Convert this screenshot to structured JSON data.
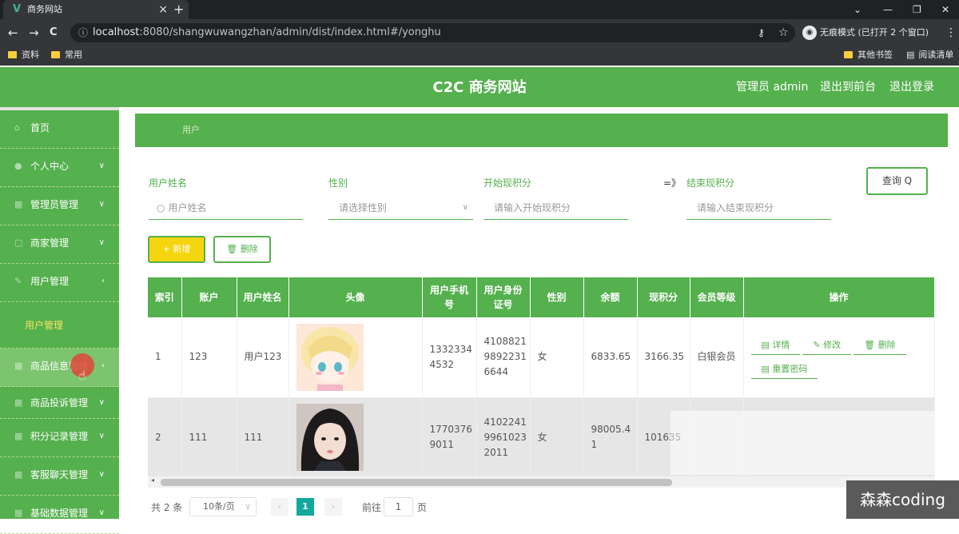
{
  "browser": {
    "tab_title": "商务网站",
    "tab_close": "×",
    "new_tab": "+",
    "url_host": "localhost",
    "url_rest": ":8080/shangwuwangzhan/admin/dist/index.html#/yonghu",
    "incognito_label": "无痕模式 (已打开 2 个窗口)",
    "bookmarks": [
      "资料",
      "常用"
    ],
    "bookmarks_right": [
      "其他书签",
      "阅读清单"
    ]
  },
  "header": {
    "title": "C2C 商务网站",
    "admin_label": "管理员 admin",
    "back_front": "退出到前台",
    "logout": "退出登录"
  },
  "sidebar": {
    "items": [
      {
        "label": "首页"
      },
      {
        "label": "个人中心"
      },
      {
        "label": "管理员管理"
      },
      {
        "label": "商家管理"
      },
      {
        "label": "用户管理"
      }
    ],
    "submenu_active": "用户管理",
    "items_after": [
      {
        "label": "商品信息管理"
      },
      {
        "label": "商品投诉管理"
      },
      {
        "label": "积分记录管理"
      },
      {
        "label": "客服聊天管理"
      },
      {
        "label": "基础数据管理"
      }
    ]
  },
  "breadcrumb": "用户",
  "search": {
    "name_label": "用户姓名",
    "name_placeholder": "用户姓名",
    "gender_label": "性别",
    "gender_placeholder": "请选择性别",
    "start_label": "开始现积分",
    "start_placeholder": "请输入开始现积分",
    "arrow": "=》",
    "end_label": "结束现积分",
    "end_placeholder": "请输入结束现积分",
    "query_button": "查询 Q"
  },
  "actions": {
    "add": "+ 新增",
    "delete": "删除"
  },
  "table": {
    "headers": [
      "索引",
      "账户",
      "用户姓名",
      "头像",
      "用户手机号",
      "用户身份证号",
      "性别",
      "余额",
      "现积分",
      "会员等级",
      "操作"
    ],
    "rows": [
      {
        "index": "1",
        "account": "123",
        "name": "用户123",
        "phone": "13323344532",
        "idcard": "410882198922316644",
        "gender": "女",
        "balance": "6833.65",
        "points": "3166.35",
        "level": "白银会员"
      },
      {
        "index": "2",
        "account": "111",
        "name": "111",
        "phone": "17703769011",
        "idcard": "410224199610232011",
        "gender": "女",
        "balance": "98005.41",
        "points": "101635",
        "level": ""
      }
    ],
    "ops": {
      "detail": "详情",
      "edit": "修改",
      "delete": "删除",
      "reset": "重置密码"
    }
  },
  "pagination": {
    "total": "共 2 条",
    "page_size": "10条/页",
    "current": "1",
    "goto_label": "前往",
    "goto_value": "1",
    "page_suffix": "页"
  },
  "watermark": "森森coding"
}
